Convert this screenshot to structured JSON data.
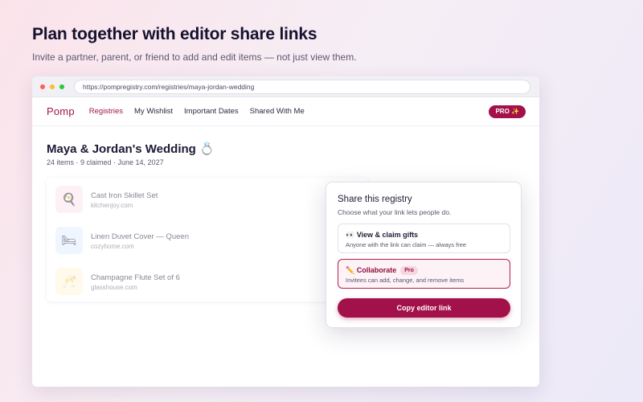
{
  "hero": {
    "headline": "Plan together with editor share links",
    "subline": "Invite a partner, parent, or friend to add and edit items — not just view them."
  },
  "browser": {
    "url": "https://pompregistry.com/registries/maya-jordan-wedding"
  },
  "nav": {
    "logo": "Pomp",
    "links": [
      "Registries",
      "My Wishlist",
      "Important Dates",
      "Shared With Me"
    ],
    "active": "Registries",
    "pro_label": "PRO ✨"
  },
  "registry": {
    "title": "Maya & Jordan's Wedding 💍",
    "meta": "24 items · 9 claimed · June 14, 2027",
    "items": [
      {
        "name": "Cast Iron Skillet Set",
        "source": "kitchenjoy.com",
        "icon": "skillet-icon",
        "emoji": "🍳",
        "tint": "#fde7ee"
      },
      {
        "name": "Linen Duvet Cover — Queen",
        "source": "cozyhome.com",
        "icon": "bed-icon",
        "emoji": "🛏",
        "tint": "#e4efff"
      },
      {
        "name": "Champagne Flute Set of 6",
        "source": "glasshouse.com",
        "icon": "champagne-icon",
        "emoji": "🥂",
        "tint": "#fff6d8"
      }
    ]
  },
  "share": {
    "title": "Share this registry",
    "subtitle": "Choose what your link lets people do.",
    "options": [
      {
        "title": "👀 View & claim gifts",
        "desc": "Anyone with the link can claim — always free",
        "selected": false
      },
      {
        "title": "✏️ Collaborate",
        "badge": "Pro",
        "desc": "Invitees can add, change, and remove items",
        "selected": true
      }
    ],
    "copy_label": "Copy editor link"
  },
  "colors": {
    "brand": "#a3114a",
    "brand_soft": "#fdf2f5"
  }
}
